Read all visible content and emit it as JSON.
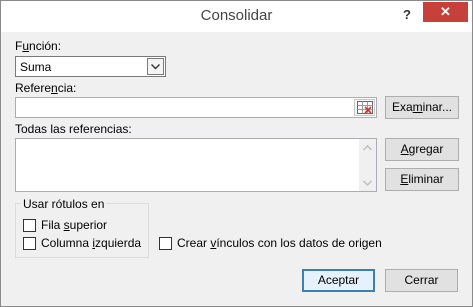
{
  "window": {
    "title": "Consolidar",
    "help_label": "?",
    "close_label": "✕"
  },
  "funcion": {
    "label_pre": "F",
    "label_ul": "u",
    "label_post": "nción:",
    "selected": "Suma"
  },
  "referencia": {
    "label_pre": "Refere",
    "label_ul": "n",
    "label_post": "cia:",
    "value": "",
    "browse_pre": "Exa",
    "browse_ul": "m",
    "browse_post": "inar..."
  },
  "todas": {
    "label": "Todas las referencias:",
    "items": []
  },
  "buttons": {
    "agregar_pre": "",
    "agregar_ul": "A",
    "agregar_post": "gregar",
    "eliminar_pre": "",
    "eliminar_ul": "E",
    "eliminar_post": "liminar",
    "aceptar": "Aceptar",
    "cerrar": "Cerrar"
  },
  "rotulos": {
    "legend": "Usar rótulos en",
    "fila_pre": "Fila ",
    "fila_ul": "s",
    "fila_post": "uperior",
    "columna_pre": "Columna ",
    "columna_ul": "i",
    "columna_post": "zquierda",
    "fila_checked": false,
    "columna_checked": false
  },
  "vinculos": {
    "label_pre": "Crear ",
    "label_ul": "v",
    "label_post": "ínculos con los datos de origen",
    "checked": false
  },
  "colors": {
    "close_bg": "#c7413a",
    "default_button_border": "#3c7fb1"
  }
}
